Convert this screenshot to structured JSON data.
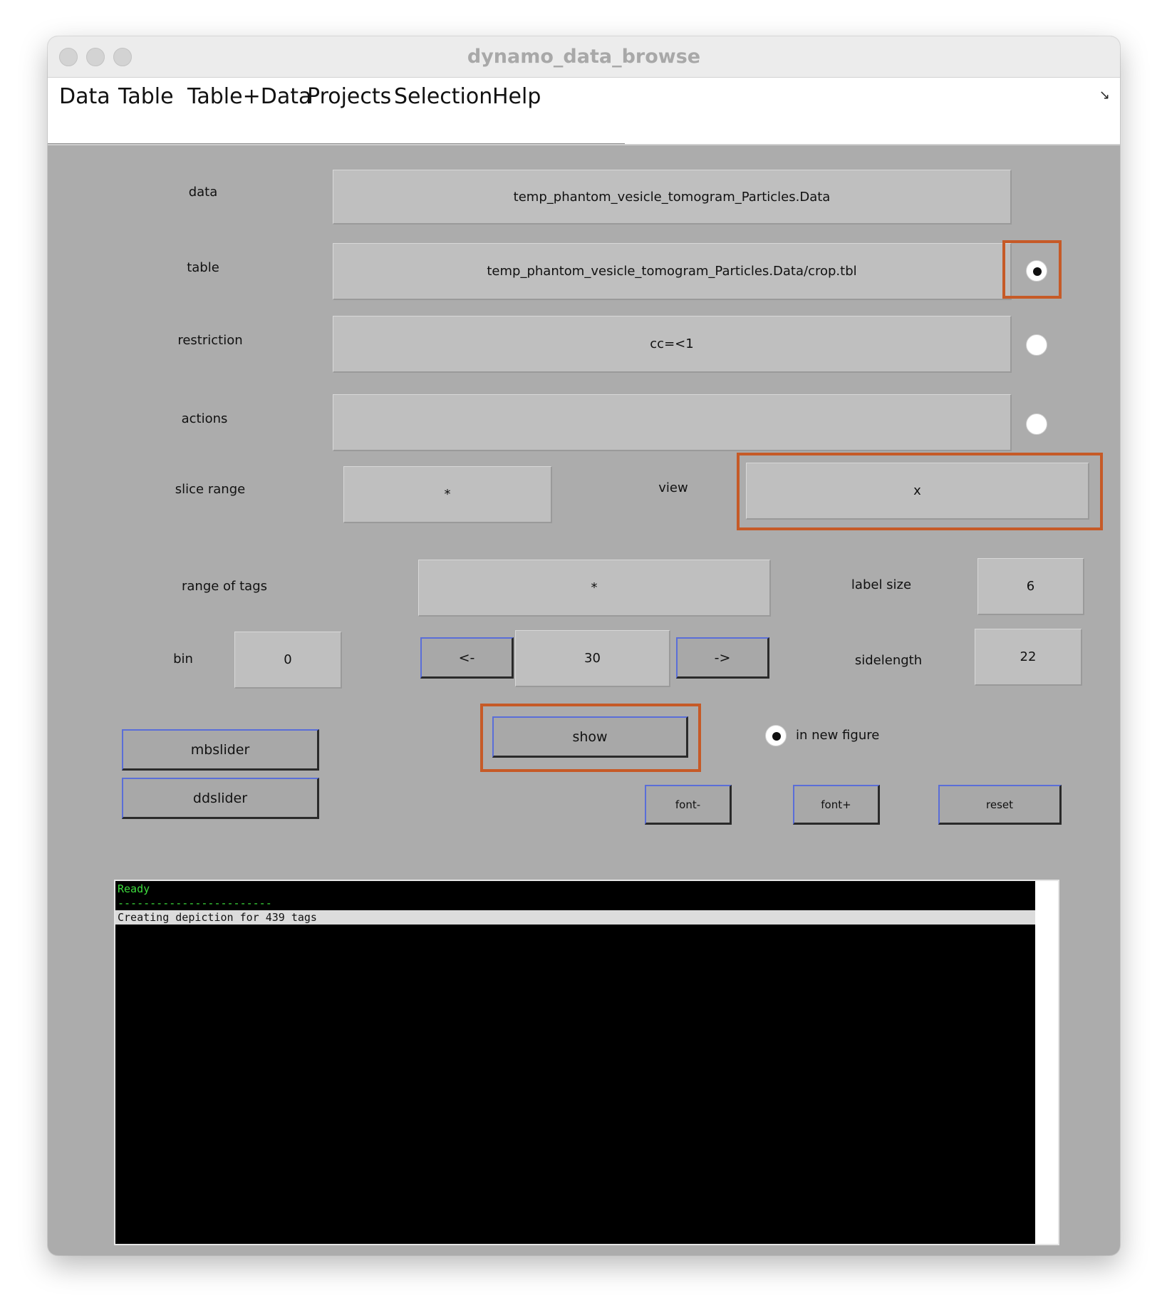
{
  "window": {
    "title": "dynamo_data_browse"
  },
  "menu": {
    "items": [
      "Data",
      "Table",
      "Table+Data",
      "Projects",
      "Selection",
      "Help"
    ],
    "resize_glyph": "↘"
  },
  "form": {
    "data": {
      "label": "data",
      "value": "temp_phantom_vesicle_tomogram_Particles.Data"
    },
    "table": {
      "label": "table",
      "value": "temp_phantom_vesicle_tomogram_Particles.Data/crop.tbl",
      "selected": true
    },
    "restriction": {
      "label": "restriction",
      "value": "cc=<1",
      "selected": false
    },
    "actions": {
      "label": "actions",
      "value": "",
      "selected": false
    },
    "slice_range": {
      "label": "slice range",
      "value": "*"
    },
    "view": {
      "label": "view",
      "value": "x"
    },
    "range_of_tags": {
      "label": "range of tags",
      "value": "*"
    },
    "label_size": {
      "label": "label size",
      "value": "6"
    },
    "bin": {
      "label": "bin",
      "value": "0"
    },
    "step_value": "30",
    "sidelength": {
      "label": "sidelength",
      "value": "22"
    }
  },
  "buttons": {
    "prev": "<-",
    "next": "->",
    "show": "show",
    "mbslider": "mbslider",
    "ddslider": "ddslider",
    "font_minus": "font-",
    "font_plus": "font+",
    "reset": "reset"
  },
  "in_new_figure": {
    "label": "in new figure",
    "selected": true
  },
  "console": {
    "ready": "Ready",
    "separator": "------------------------",
    "message": "Creating depiction for 439 tags"
  },
  "colors": {
    "highlight": "#c65a27",
    "console_ready": "#3ddc3d",
    "window_bg": "#acacac"
  }
}
